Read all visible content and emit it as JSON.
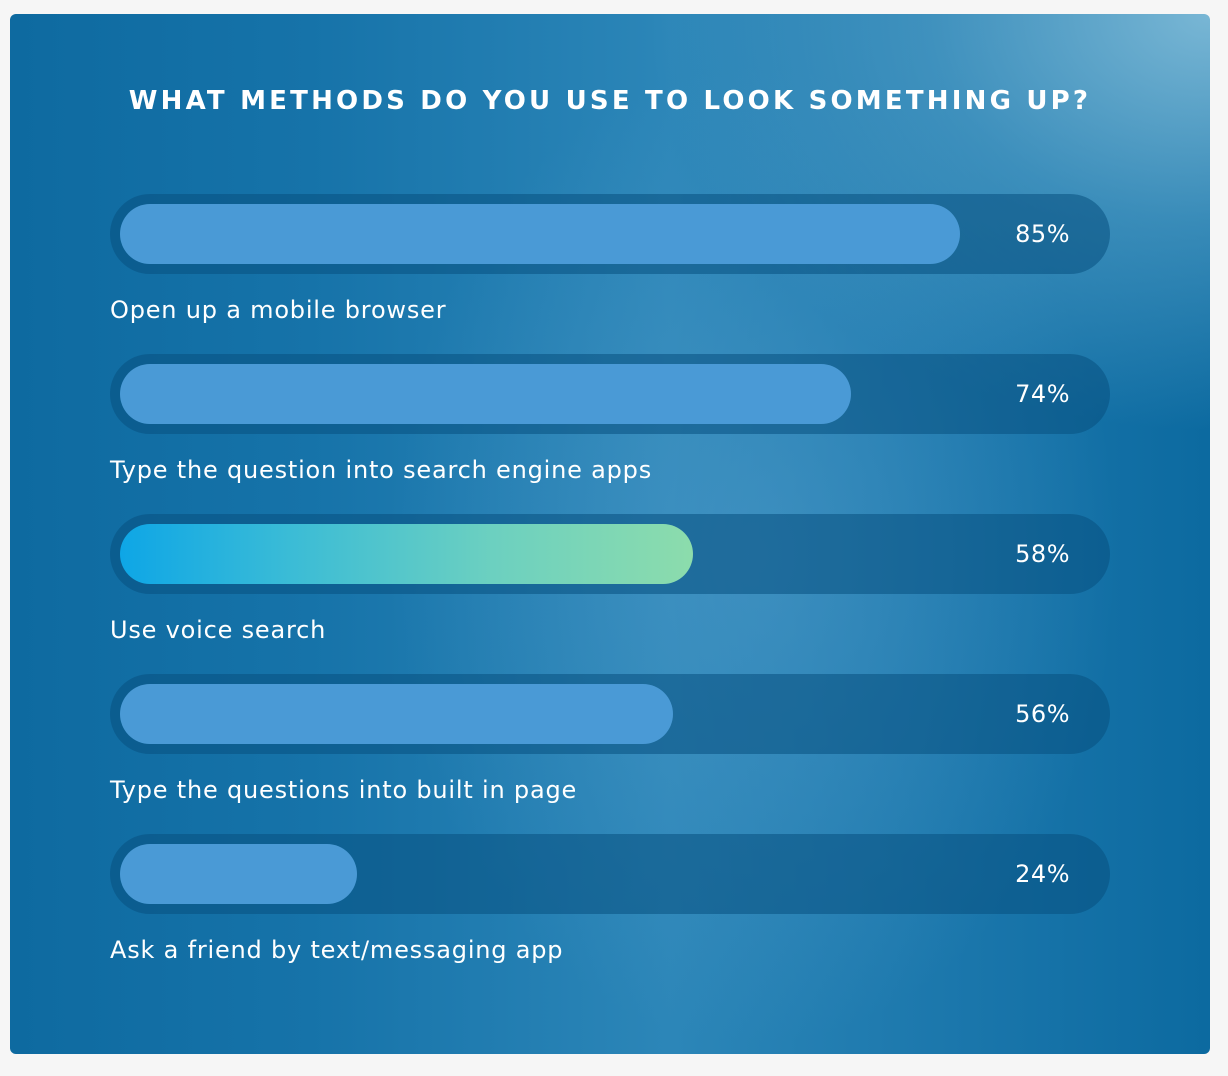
{
  "chart_data": {
    "type": "bar",
    "orientation": "horizontal",
    "title": "WHAT METHODS DO YOU USE TO LOOK SOMETHING UP?",
    "categories": [
      "Open up a mobile browser",
      "Type the question into search engine apps",
      "Use voice search",
      "Type the questions into built in page",
      "Ask a friend by text/messaging app"
    ],
    "values": [
      85,
      74,
      58,
      56,
      24
    ],
    "value_labels": [
      "85%",
      "74%",
      "58%",
      "56%",
      "24%"
    ],
    "xlim": [
      0,
      100
    ],
    "grid": false,
    "highlighted_index": 2,
    "colors": {
      "bar": "#4a9ad6",
      "highlight_start": "#0ea6e6",
      "highlight_end": "#8cdcac",
      "track": "#0a5a8e",
      "text": "#ffffff"
    }
  }
}
